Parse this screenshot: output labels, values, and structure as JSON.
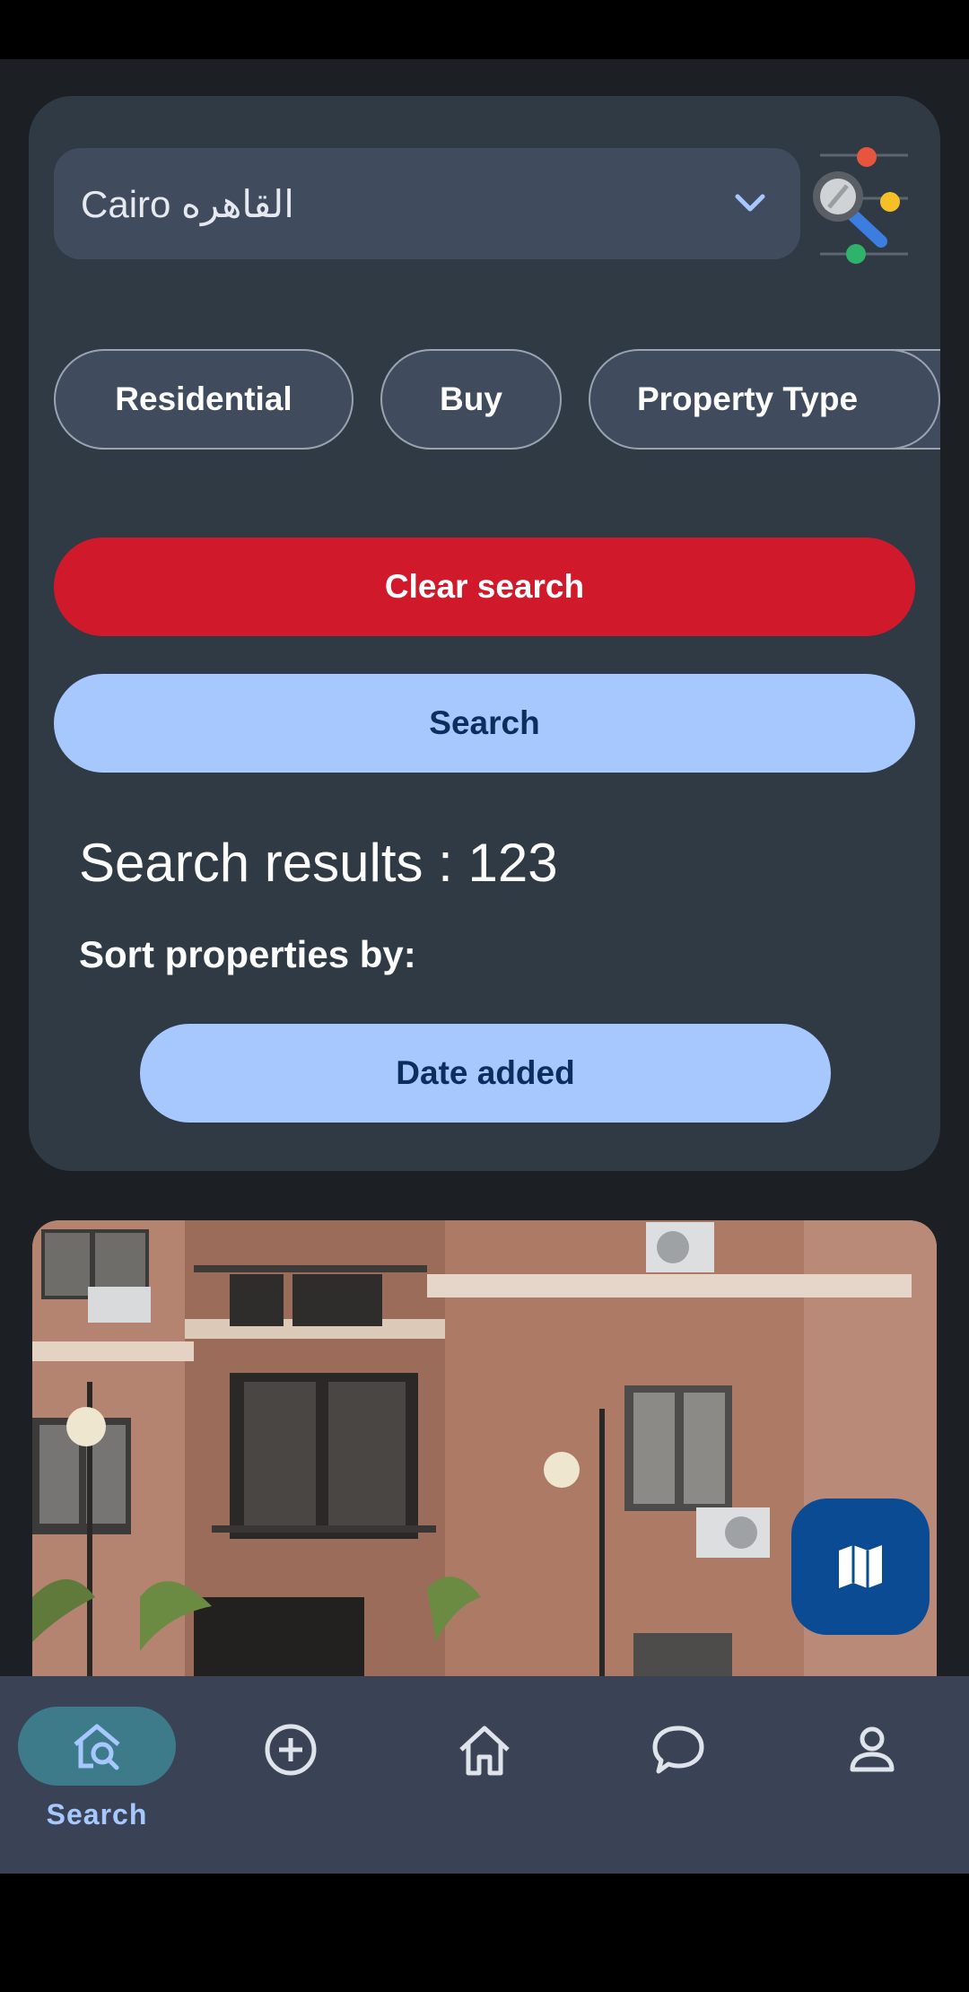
{
  "location_select": {
    "value": "Cairo القاهره"
  },
  "filters": {
    "chips": [
      "Residential",
      "Buy",
      "Property Type"
    ]
  },
  "actions": {
    "clear_label": "Clear search",
    "search_label": "Search"
  },
  "results": {
    "label": "Search results : 123",
    "sort_heading": "Sort properties by:",
    "sort_value": "Date added"
  },
  "bottom_nav": {
    "items": [
      {
        "icon": "search-home-icon",
        "label": "Search",
        "active": true
      },
      {
        "icon": "add-circle-icon"
      },
      {
        "icon": "home-icon"
      },
      {
        "icon": "chat-icon"
      },
      {
        "icon": "account-icon"
      }
    ]
  },
  "colors": {
    "accent_red": "#d01a2c",
    "accent_blue": "#a6c8ff",
    "card_bg": "#2f3a44",
    "fab_bg": "#0b4b94"
  }
}
